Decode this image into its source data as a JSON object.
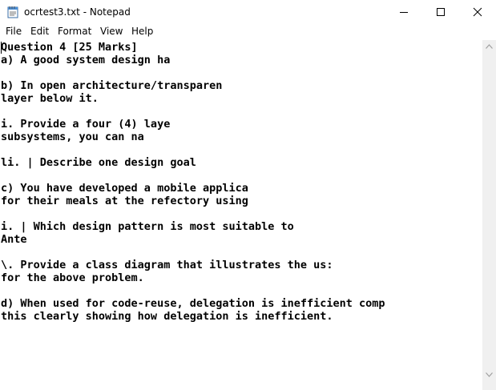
{
  "window": {
    "title": "ocrtest3.txt - Notepad"
  },
  "menu": {
    "items": [
      "File",
      "Edit",
      "Format",
      "View",
      "Help"
    ]
  },
  "editor": {
    "lines": [
      "Question 4 [25 Marks]",
      "a) A good system design ha",
      "",
      "b) In open architecture/transparen",
      "layer below it.",
      "",
      "i. Provide a four (4) laye",
      "subsystems, you can na",
      "",
      "li. | Describe one design goal",
      "",
      "c) You have developed a mobile applica",
      "for their meals at the refectory using",
      "",
      "i. | Which design pattern is most suitable to",
      "Ante",
      "",
      "\\. Provide a class diagram that illustrates the us:",
      "for the above problem.",
      "",
      "d) When used for code-reuse, delegation is inefficient comp",
      "this clearly showing how delegation is inefficient."
    ]
  },
  "icons": {
    "app": "notepad-icon",
    "minimize": "minimize-icon",
    "maximize": "maximize-icon",
    "close": "close-icon",
    "scroll_up": "chevron-up-icon",
    "scroll_down": "chevron-down-icon"
  },
  "colors": {
    "background": "#ffffff",
    "text": "#000000",
    "scrollbar_track": "#f0f0f0",
    "scroll_arrow": "#a0a0a0"
  }
}
